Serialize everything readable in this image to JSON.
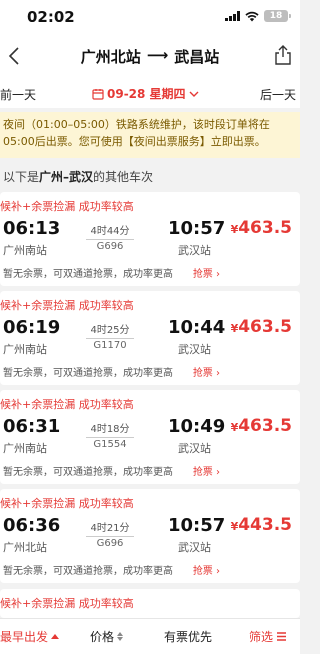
{
  "status": {
    "time": "02:02",
    "battery": "18"
  },
  "nav": {
    "from": "广州北站",
    "arrow": "⟶",
    "to": "武昌站"
  },
  "date_bar": {
    "prev": "前一天",
    "date": "09-28 星期四",
    "next": "后一天"
  },
  "notice": {
    "text": "夜间（01:00–05:00）铁路系统维护，该时段订单将在05:00后出票。您可使用【夜间出票服务】立即出票。"
  },
  "section": {
    "prefix": "以下是",
    "route": "广州–武汉",
    "suffix": "的其他车次"
  },
  "trains": [
    {
      "tag": "候补+余票捡漏 成功率较高",
      "dep_time": "06:13",
      "dep_station": "广州南站",
      "duration": "4时44分",
      "train_no": "G696",
      "arr_time": "10:57",
      "arr_station": "武汉站",
      "price_symbol": "¥",
      "price": "463.5",
      "note": "暂无余票，可双通道抢票，成功率更高",
      "action": "抢票 ›"
    },
    {
      "tag": "候补+余票捡漏 成功率较高",
      "dep_time": "06:19",
      "dep_station": "广州南站",
      "duration": "4时25分",
      "train_no": "G1170",
      "arr_time": "10:44",
      "arr_station": "武汉站",
      "price_symbol": "¥",
      "price": "463.5",
      "note": "暂无余票，可双通道抢票，成功率更高",
      "action": "抢票 ›"
    },
    {
      "tag": "候补+余票捡漏 成功率较高",
      "dep_time": "06:31",
      "dep_station": "广州南站",
      "duration": "4时18分",
      "train_no": "G1554",
      "arr_time": "10:49",
      "arr_station": "武汉站",
      "price_symbol": "¥",
      "price": "463.5",
      "note": "暂无余票，可双通道抢票，成功率更高",
      "action": "抢票 ›"
    },
    {
      "tag": "候补+余票捡漏 成功率较高",
      "dep_time": "06:36",
      "dep_station": "广州北站",
      "duration": "4时21分",
      "train_no": "G696",
      "arr_time": "10:57",
      "arr_station": "武汉站",
      "price_symbol": "¥",
      "price": "443.5",
      "note": "暂无余票，可双通道抢票，成功率更高",
      "action": "抢票 ›"
    },
    {
      "tag": "候补+余票捡漏 成功率较高"
    }
  ],
  "bottom": {
    "sort_depart": "最早出发",
    "sort_price": "价格",
    "has_ticket": "有票优先",
    "filter": "筛选"
  },
  "colors": {
    "accent": "#e53935",
    "notice_bg": "#fdf5d5"
  }
}
